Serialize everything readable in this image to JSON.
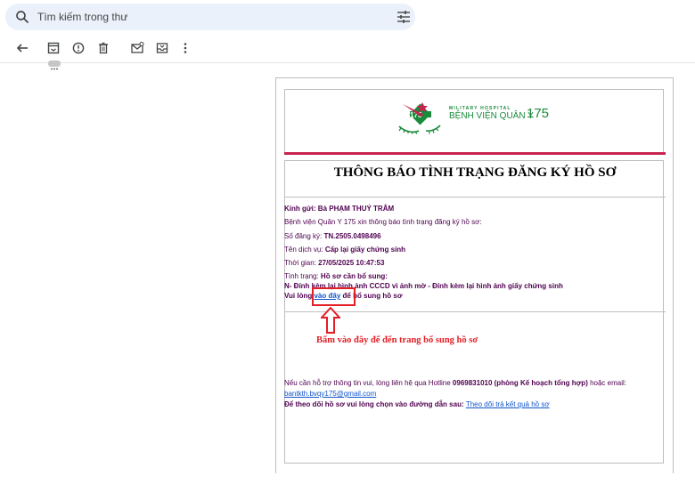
{
  "search": {
    "placeholder": "Tìm kiếm trong thư"
  },
  "toolbar": {
    "icons": [
      "back-arrow-icon",
      "archive-icon",
      "report-spam-icon",
      "delete-icon",
      "mark-unread-icon",
      "move-to-icon",
      "more-options-icon"
    ]
  },
  "email": {
    "logo": {
      "small_text": "MILITARY HOSPITAL",
      "name": "BỆNH VIỆN QUÂN Y",
      "number": "175"
    },
    "title": "THÔNG BÁO TÌNH TRẠNG ĐĂNG KÝ HỒ SƠ",
    "greeting_label": "Kính gửi: ",
    "recipient": "Bà PHẠM THUÝ TRÂM",
    "intro": "Bệnh viện Quân Y 175 xin thông báo tình trạng đăng ký hồ sơ:",
    "reg_label": "Số đăng ký: ",
    "reg_value": "TN.2505.0498496",
    "service_label": "Tên dịch vụ: ",
    "service_value": "Cấp lại giấy chứng sinh",
    "time_label": "Thời gian: ",
    "time_value": "27/05/2025 10:47:53",
    "status_label": "Tình trạng: ",
    "status_value": "Hồ sơ cần bổ sung:",
    "status_detail": "N- Đính kèm lại hình ảnh CCCD vì ảnh mờ - Đính kèm lại hình ảnh giấy chứng sinh",
    "cta_prefix": "Vui lòng ",
    "cta_link": "vào đây",
    "cta_suffix": " để bổ sung hồ sơ",
    "annotation": "Bấm vào đây để đến trang bổ sung hồ sơ",
    "support_prefix": "Nếu cần hỗ trợ thông tin vui, lòng liên hệ qua Hotline ",
    "support_hotline": "0969831010 (phòng Kế hoạch tổng hợp)",
    "support_suffix": " hoặc email:",
    "support_email": "bantkth.bvqy175@gmail.com",
    "track_prefix": "Để theo dõi hồ sơ vui lòng chọn vào đường dẫn sau: ",
    "track_link": "Theo dõi trả kết quả hồ sơ"
  },
  "colors": {
    "accent_red": "#e31e24",
    "brand_green": "#1a8a3c",
    "header_line": "#c8224e",
    "link_blue": "#1155cc",
    "text_purple": "#500050"
  }
}
